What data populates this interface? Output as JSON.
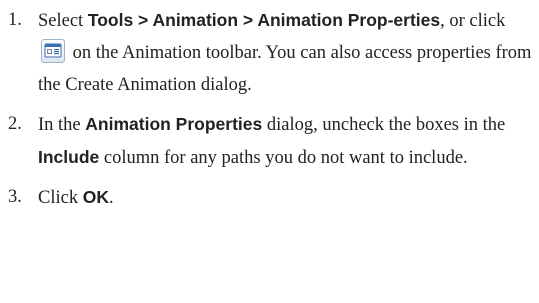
{
  "steps": [
    {
      "number": "1.",
      "t1": "Select ",
      "t2": "Tools > Animation > Animation Prop-erties",
      "t3": ", or click ",
      "icon": "animation-properties-icon",
      "t4": " on the Animation toolbar. You can also access properties from the Create Animation dialog."
    },
    {
      "number": "2.",
      "t1": "In the ",
      "t2": "Animation Properties",
      "t3": " dialog, uncheck the boxes in the ",
      "t4": "Include",
      "t5": " column for any paths you do not want to include."
    },
    {
      "number": "3.",
      "t1": "Click ",
      "t2": "OK",
      "t3": "."
    }
  ],
  "colors": {
    "text": "#222222",
    "icon_border": "#9fb4cc",
    "icon_accent": "#3b6fb6"
  }
}
